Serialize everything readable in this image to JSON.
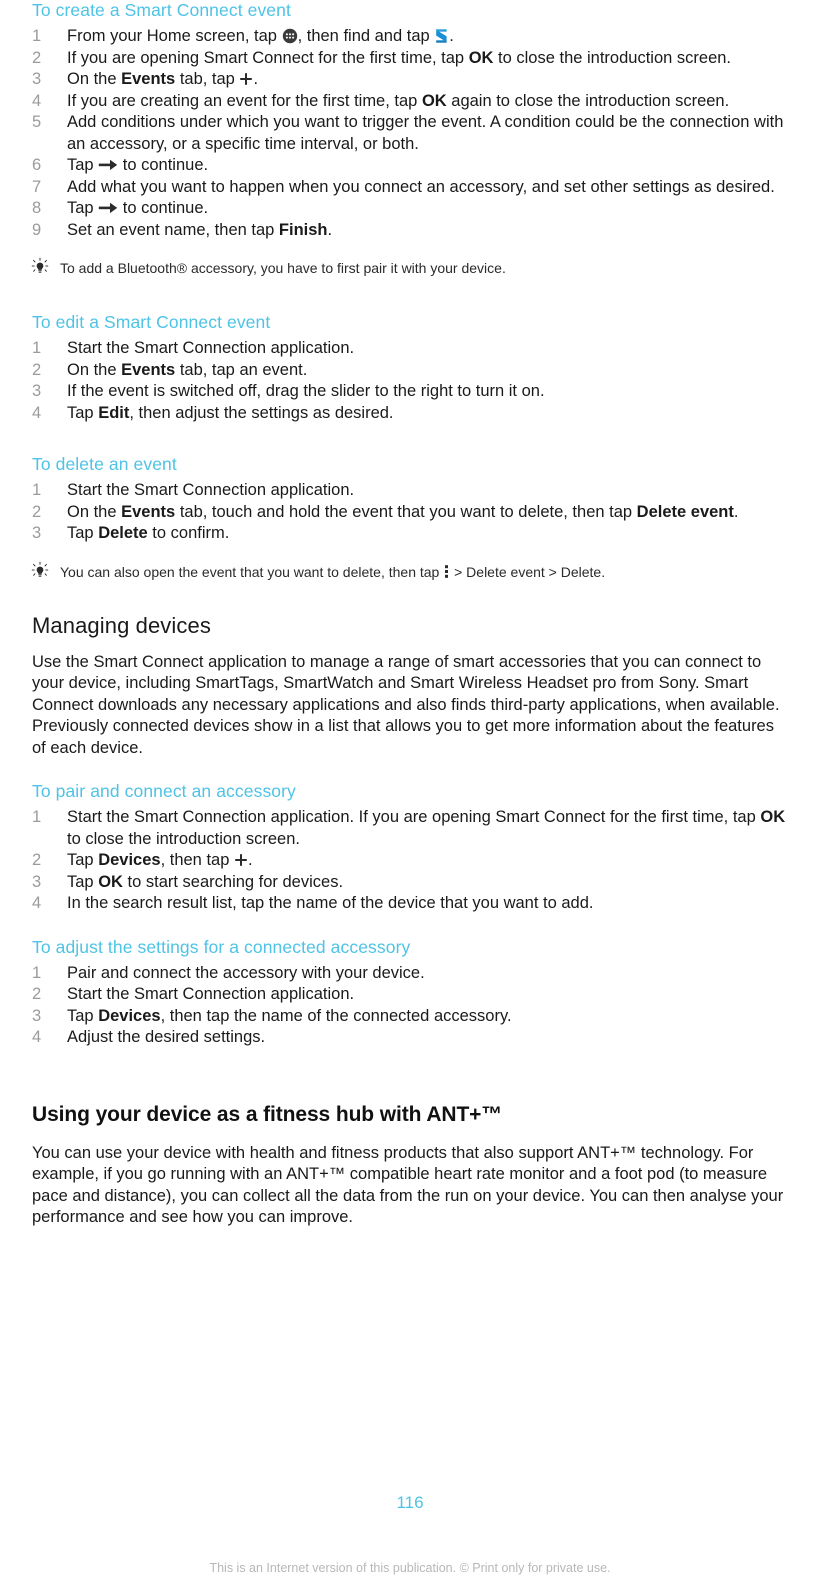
{
  "document": {
    "page_number": "116",
    "footer_note": "This is an Internet version of this publication. © Print only for private use.",
    "accent_color": "#4ec3e6",
    "body_color": "#1a1a1a",
    "step_number_color": "#9b9b9b"
  },
  "sections": {
    "create_event": {
      "heading": "To create a Smart Connect event",
      "steps": [
        {
          "pre": "From your Home screen, tap ",
          "icon1": "app-drawer-icon",
          "mid": ", then find and tap ",
          "icon2": "smart-connect-icon",
          "post": "."
        },
        {
          "pre": "If you are opening Smart Connect for the first time, tap ",
          "bold": "OK",
          "post": " to close the introduction screen."
        },
        {
          "pre": "On the ",
          "bold": "Events",
          "mid": " tab, tap ",
          "icon1": "plus-icon",
          "post": "."
        },
        {
          "pre": "If you are creating an event for the first time, tap ",
          "bold": "OK",
          "post": " again to close the introduction screen."
        },
        {
          "pre": "Add conditions under which you want to trigger the event. A condition could be the connection with an accessory, or a specific time interval, or both."
        },
        {
          "pre": "Tap ",
          "icon1": "arrow-right-icon",
          "post": " to continue."
        },
        {
          "pre": "Add what you want to happen when you connect an accessory, and set other settings as desired."
        },
        {
          "pre": "Tap ",
          "icon1": "arrow-right-icon",
          "post": " to continue."
        },
        {
          "pre": "Set an event name, then tap ",
          "bold": "Finish",
          "post": "."
        }
      ],
      "tip": "To add a Bluetooth® accessory, you have to first pair it with your device."
    },
    "edit_event": {
      "heading": "To edit a Smart Connect event",
      "steps": [
        {
          "pre": "Start the Smart Connection application."
        },
        {
          "pre": "On the ",
          "bold": "Events",
          "post": " tab, tap an event."
        },
        {
          "pre": "If the event is switched off, drag the slider to the right to turn it on."
        },
        {
          "pre": "Tap ",
          "bold": "Edit",
          "post": ", then adjust the settings as desired."
        }
      ]
    },
    "delete_event": {
      "heading": "To delete an event",
      "steps": [
        {
          "pre": "Start the Smart Connection application."
        },
        {
          "pre": "On the ",
          "bold": "Events",
          "mid": " tab, touch and hold the event that you want to delete, then tap ",
          "bold2": "Delete event",
          "post": "."
        },
        {
          "pre": "Tap ",
          "bold": "Delete",
          "post": " to confirm."
        }
      ],
      "tip_pre": "You can also open the event that you want to delete, then tap ",
      "tip_icon": "kebab-menu-icon",
      "tip_post": " > Delete event > Delete."
    },
    "managing_devices": {
      "heading": "Managing devices",
      "paragraph": "Use the Smart Connect application to manage a range of smart accessories that you can connect to your device, including SmartTags, SmartWatch and Smart Wireless Headset pro from Sony. Smart Connect downloads any necessary applications and also finds third-party applications, when available. Previously connected devices show in a list that allows you to get more information about the features of each device."
    },
    "pair_accessory": {
      "heading": "To pair and connect an accessory",
      "steps": [
        {
          "pre": "Start the Smart Connection application. If you are opening Smart Connect for the first time, tap ",
          "bold": "OK",
          "post": " to close the introduction screen."
        },
        {
          "pre": "Tap ",
          "bold": "Devices",
          "mid": ", then tap ",
          "icon1": "plus-icon",
          "post": "."
        },
        {
          "pre": "Tap ",
          "bold": "OK",
          "post": " to start searching for devices."
        },
        {
          "pre": "In the search result list, tap the name of the device that you want to add."
        }
      ]
    },
    "adjust_settings": {
      "heading": "To adjust the settings for a connected accessory",
      "steps": [
        {
          "pre": "Pair and connect the accessory with your device."
        },
        {
          "pre": "Start the Smart Connection application."
        },
        {
          "pre": "Tap ",
          "bold": "Devices",
          "post": ", then tap the name of the connected accessory."
        },
        {
          "pre": "Adjust the desired settings."
        }
      ]
    },
    "ant_plus": {
      "heading": "Using your device as a fitness hub with ANT+™",
      "paragraph": "You can use your device with health and fitness products that also support ANT+™ technology. For example, if you go running with an ANT+™ compatible heart rate monitor and a foot pod (to measure pace and distance), you can collect all the data from the run on your device. You can then analyse your performance and see how you can improve."
    }
  }
}
